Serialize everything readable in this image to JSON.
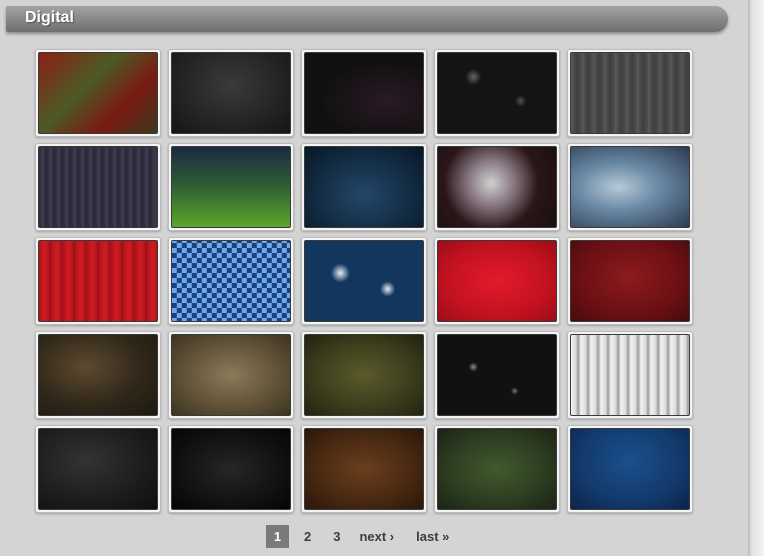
{
  "section": {
    "title": "Digital"
  },
  "thumbnails": [
    {
      "icon": "texture-thumbnail",
      "bg": "linear-gradient(135deg,#8e1e15 0%,#4c5a24 40%,#7a1a12 70%,#3a3a20 100%)"
    },
    {
      "icon": "texture-thumbnail",
      "bg": "radial-gradient(ellipse at 50% 40%,#3a3a3a 0%,#202020 70%,#151515 100%)"
    },
    {
      "icon": "texture-thumbnail",
      "bg": "radial-gradient(ellipse at 70% 60%,#2a1a24 0%,#101010 60%),linear-gradient(160deg,#273b2f 0%,#0e0e0e 55%)"
    },
    {
      "icon": "texture-thumbnail",
      "bg": "radial-gradient(circle at 30% 30%,#666 0%,transparent 8%),radial-gradient(circle at 70% 60%,#555 0%,transparent 6%),#141414"
    },
    {
      "icon": "texture-thumbnail",
      "bg": "repeating-linear-gradient(90deg,#5a5a5a 0px,#3e3e3e 6px,#4f4f4f 11px),#444"
    },
    {
      "icon": "texture-thumbnail",
      "bg": "repeating-linear-gradient(90deg,#2d2b3c 0px,#3f3b52 4px,#24222e 8px)"
    },
    {
      "icon": "texture-thumbnail",
      "bg": "linear-gradient(to bottom,#1b2a44 0%,#2c5a34 45%,#5aa62a 100%)"
    },
    {
      "icon": "texture-thumbnail",
      "bg": "radial-gradient(ellipse at 50% 60%,#24476a 0%,#112a40 60%,#081624 100%)"
    },
    {
      "icon": "texture-thumbnail",
      "bg": "radial-gradient(circle at 45% 45%,#d0d0d0 0%,#8a7a84 28%,#2a1618 60%,#1a0e10 100%)"
    },
    {
      "icon": "texture-thumbnail",
      "bg": "radial-gradient(ellipse at 40% 50%,#b7c9d6 0%,#6b8aa6 40%,#2b3a50 100%)"
    },
    {
      "icon": "texture-thumbnail",
      "bg": "repeating-linear-gradient(90deg,#b1121a 0px,#d01c22 6px,#9c0f17 12px)"
    },
    {
      "icon": "texture-thumbnail",
      "bg": "repeating-conic-gradient(#1c3f7e 0% 25%,#6ea8e8 0% 50%) 60% 60% / 10px 10px,linear-gradient(135deg,#5fa8e8,#1d4f9e)"
    },
    {
      "icon": "texture-thumbnail",
      "bg": "radial-gradient(circle at 30% 40%,#e6eef5 0%,transparent 10%),radial-gradient(circle at 70% 60%,#e6eef5 0%,transparent 8%),#13365e"
    },
    {
      "icon": "texture-thumbnail",
      "bg": "radial-gradient(ellipse at 50% 50%,#e21a2b 0%,#c3121f 60%,#9b0d18 100%)"
    },
    {
      "icon": "texture-thumbnail",
      "bg": "radial-gradient(ellipse at 50% 45%,#8d1a1d 0%,#6b1014 60%,#470a0c 100%)"
    },
    {
      "icon": "texture-thumbnail",
      "bg": "radial-gradient(ellipse at 40% 40%,#5e4a2e 0%,#30281a 55%,#1c1810 100%)"
    },
    {
      "icon": "texture-thumbnail",
      "bg": "radial-gradient(ellipse at 50% 50%,#8b7a5a 0%,#5e5036 60%,#3c3322 100%)"
    },
    {
      "icon": "texture-thumbnail",
      "bg": "radial-gradient(ellipse at 50% 50%,#5a5a2a 0%,#3e3e1e 55%,#22220f 100%)"
    },
    {
      "icon": "texture-thumbnail",
      "bg": "radial-gradient(circle at 30% 40%,#888 0%,transparent 5%),radial-gradient(circle at 65% 70%,#777 0%,transparent 4%),#111"
    },
    {
      "icon": "texture-thumbnail",
      "bg": "repeating-linear-gradient(90deg,#f3f3f3 0px,#d8d8d8 5px,#9a9a9a 7px,#f0f0f0 10px)"
    },
    {
      "icon": "texture-thumbnail",
      "bg": "radial-gradient(ellipse at 40% 40%,#333 0%,#1c1c1c 60%,#0f0f0f 100%)"
    },
    {
      "icon": "texture-thumbnail",
      "bg": "radial-gradient(ellipse at 50% 50%,#262626 0%,#0e0e0e 70%,#050505 100%)"
    },
    {
      "icon": "texture-thumbnail",
      "bg": "radial-gradient(ellipse at 50% 50%,#6a3e1c 0%,#4a2a12 55%,#2a170a 100%)"
    },
    {
      "icon": "texture-thumbnail",
      "bg": "radial-gradient(ellipse at 50% 50%,#3f5a2c 0%,#2e3e22 55%,#1b2414 100%)"
    },
    {
      "icon": "texture-thumbnail",
      "bg": "radial-gradient(ellipse at 50% 40%,#1b4f8e 0%,#123a6c 60%,#0a2448 100%)"
    }
  ],
  "pagination": {
    "current": "1",
    "page2": "2",
    "page3": "3",
    "next": "next ›",
    "last": "last »"
  }
}
